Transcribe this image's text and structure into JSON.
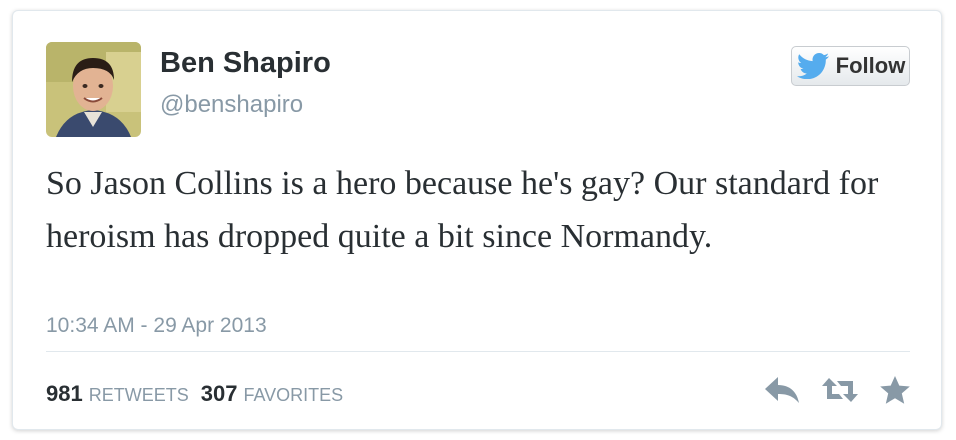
{
  "profile": {
    "name": "Ben Shapiro",
    "handle": "@benshapiro"
  },
  "follow_button": {
    "label": "Follow",
    "icon": "twitter-bird-icon"
  },
  "tweet": {
    "text": "So Jason Collins is a hero because he's gay? Our standard for heroism has dropped quite a bit since Normandy.",
    "timestamp": "10:34 AM - 29 Apr 2013"
  },
  "stats": {
    "retweets_count": "981",
    "retweets_label": "RETWEETS",
    "favorites_count": "307",
    "favorites_label": "FAVORITES"
  },
  "actions": [
    "reply-icon",
    "retweet-icon",
    "favorite-star-icon"
  ],
  "colors": {
    "text": "#292f33",
    "muted": "#8899a6",
    "twitter_blue": "#55acee",
    "action_gray": "#8899a6"
  }
}
